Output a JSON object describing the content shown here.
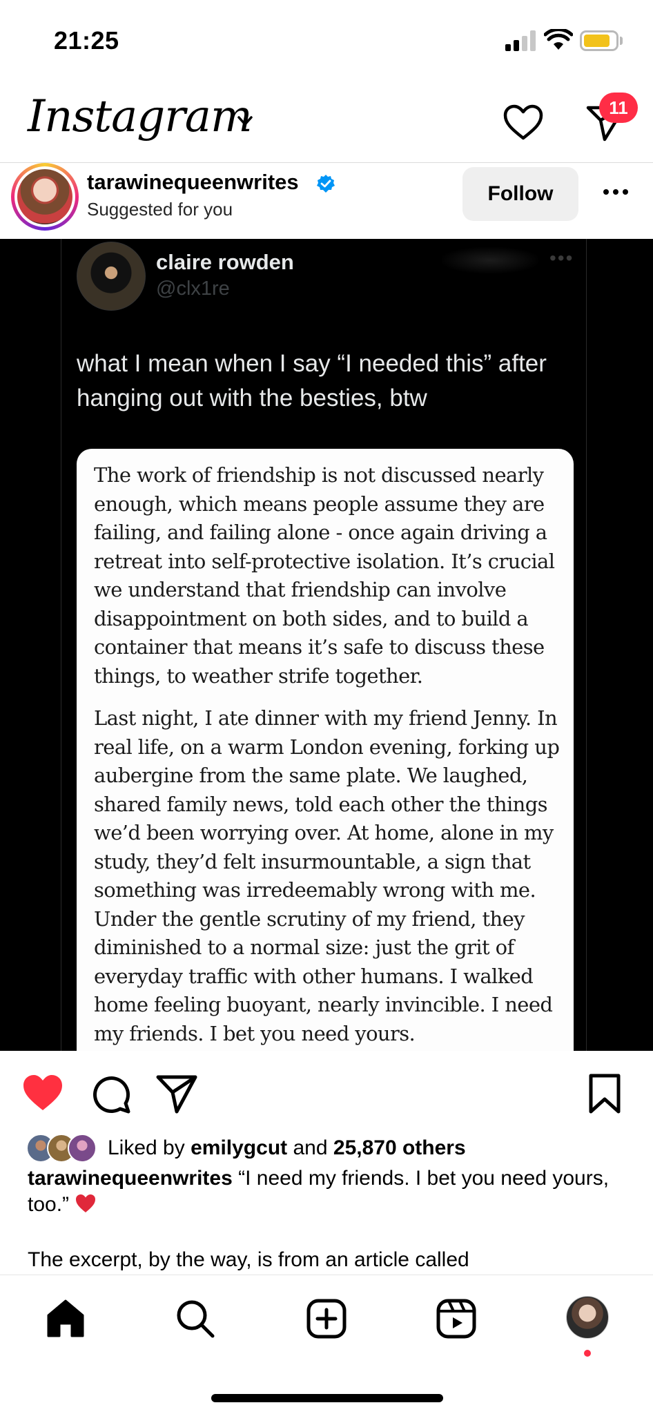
{
  "status_bar": {
    "time": "21:25",
    "battery_color": "#f2c21b"
  },
  "header": {
    "logo": "Instagram",
    "dm_badge": "11",
    "badge_color": "#ff2d46"
  },
  "post": {
    "username": "tarawinequeenwrites",
    "subtitle": "Suggested for you",
    "follow_label": "Follow"
  },
  "tweet": {
    "name": "claire rowden",
    "handle": "@clx1re",
    "text": "what I mean when I say “I needed this” after hanging out with the besties, btw",
    "article_paragraphs": [
      "The work of friendship is not discussed nearly enough, which means people assume they are failing, and failing alone - once again driving a retreat into self-protective isolation. It’s crucial we understand that friendship can involve disappointment on both sides, and to build a container that means it’s safe to discuss these things, to weather strife together.",
      "Last night, I ate dinner with my friend Jenny. In real life, on a warm London evening, forking up aubergine from the same plate. We laughed, shared family news, told each other the things we’d been worrying over. At home, alone in my study, they’d felt insurmountable, a sign that something was irredeemably wrong with me. Under the gentle scrutiny of my friend, they diminished to a normal size: just the grit of everyday traffic with other humans. I walked home feeling buoyant, nearly invincible. I need my friends. I bet you need yours."
    ]
  },
  "engagement": {
    "liked": true,
    "like_color": "#ff3040",
    "liked_by_prefix": "Liked by",
    "liked_by_user": "emilygcut",
    "and_word": "and",
    "others_count": "25,870 others"
  },
  "caption": {
    "username": "tarawinequeenwrites",
    "text": "“I need my friends. I bet you need yours, too.”",
    "more": "The excerpt, by the way, is from an article called"
  },
  "icons": {
    "header": [
      "heart-icon",
      "direct-message-icon",
      "chevron-down-icon"
    ],
    "actions": [
      "heart-filled-icon",
      "comment-icon",
      "share-icon",
      "bookmark-icon"
    ],
    "nav": [
      "home-icon",
      "search-icon",
      "create-icon",
      "reels-icon",
      "profile-avatar"
    ]
  }
}
